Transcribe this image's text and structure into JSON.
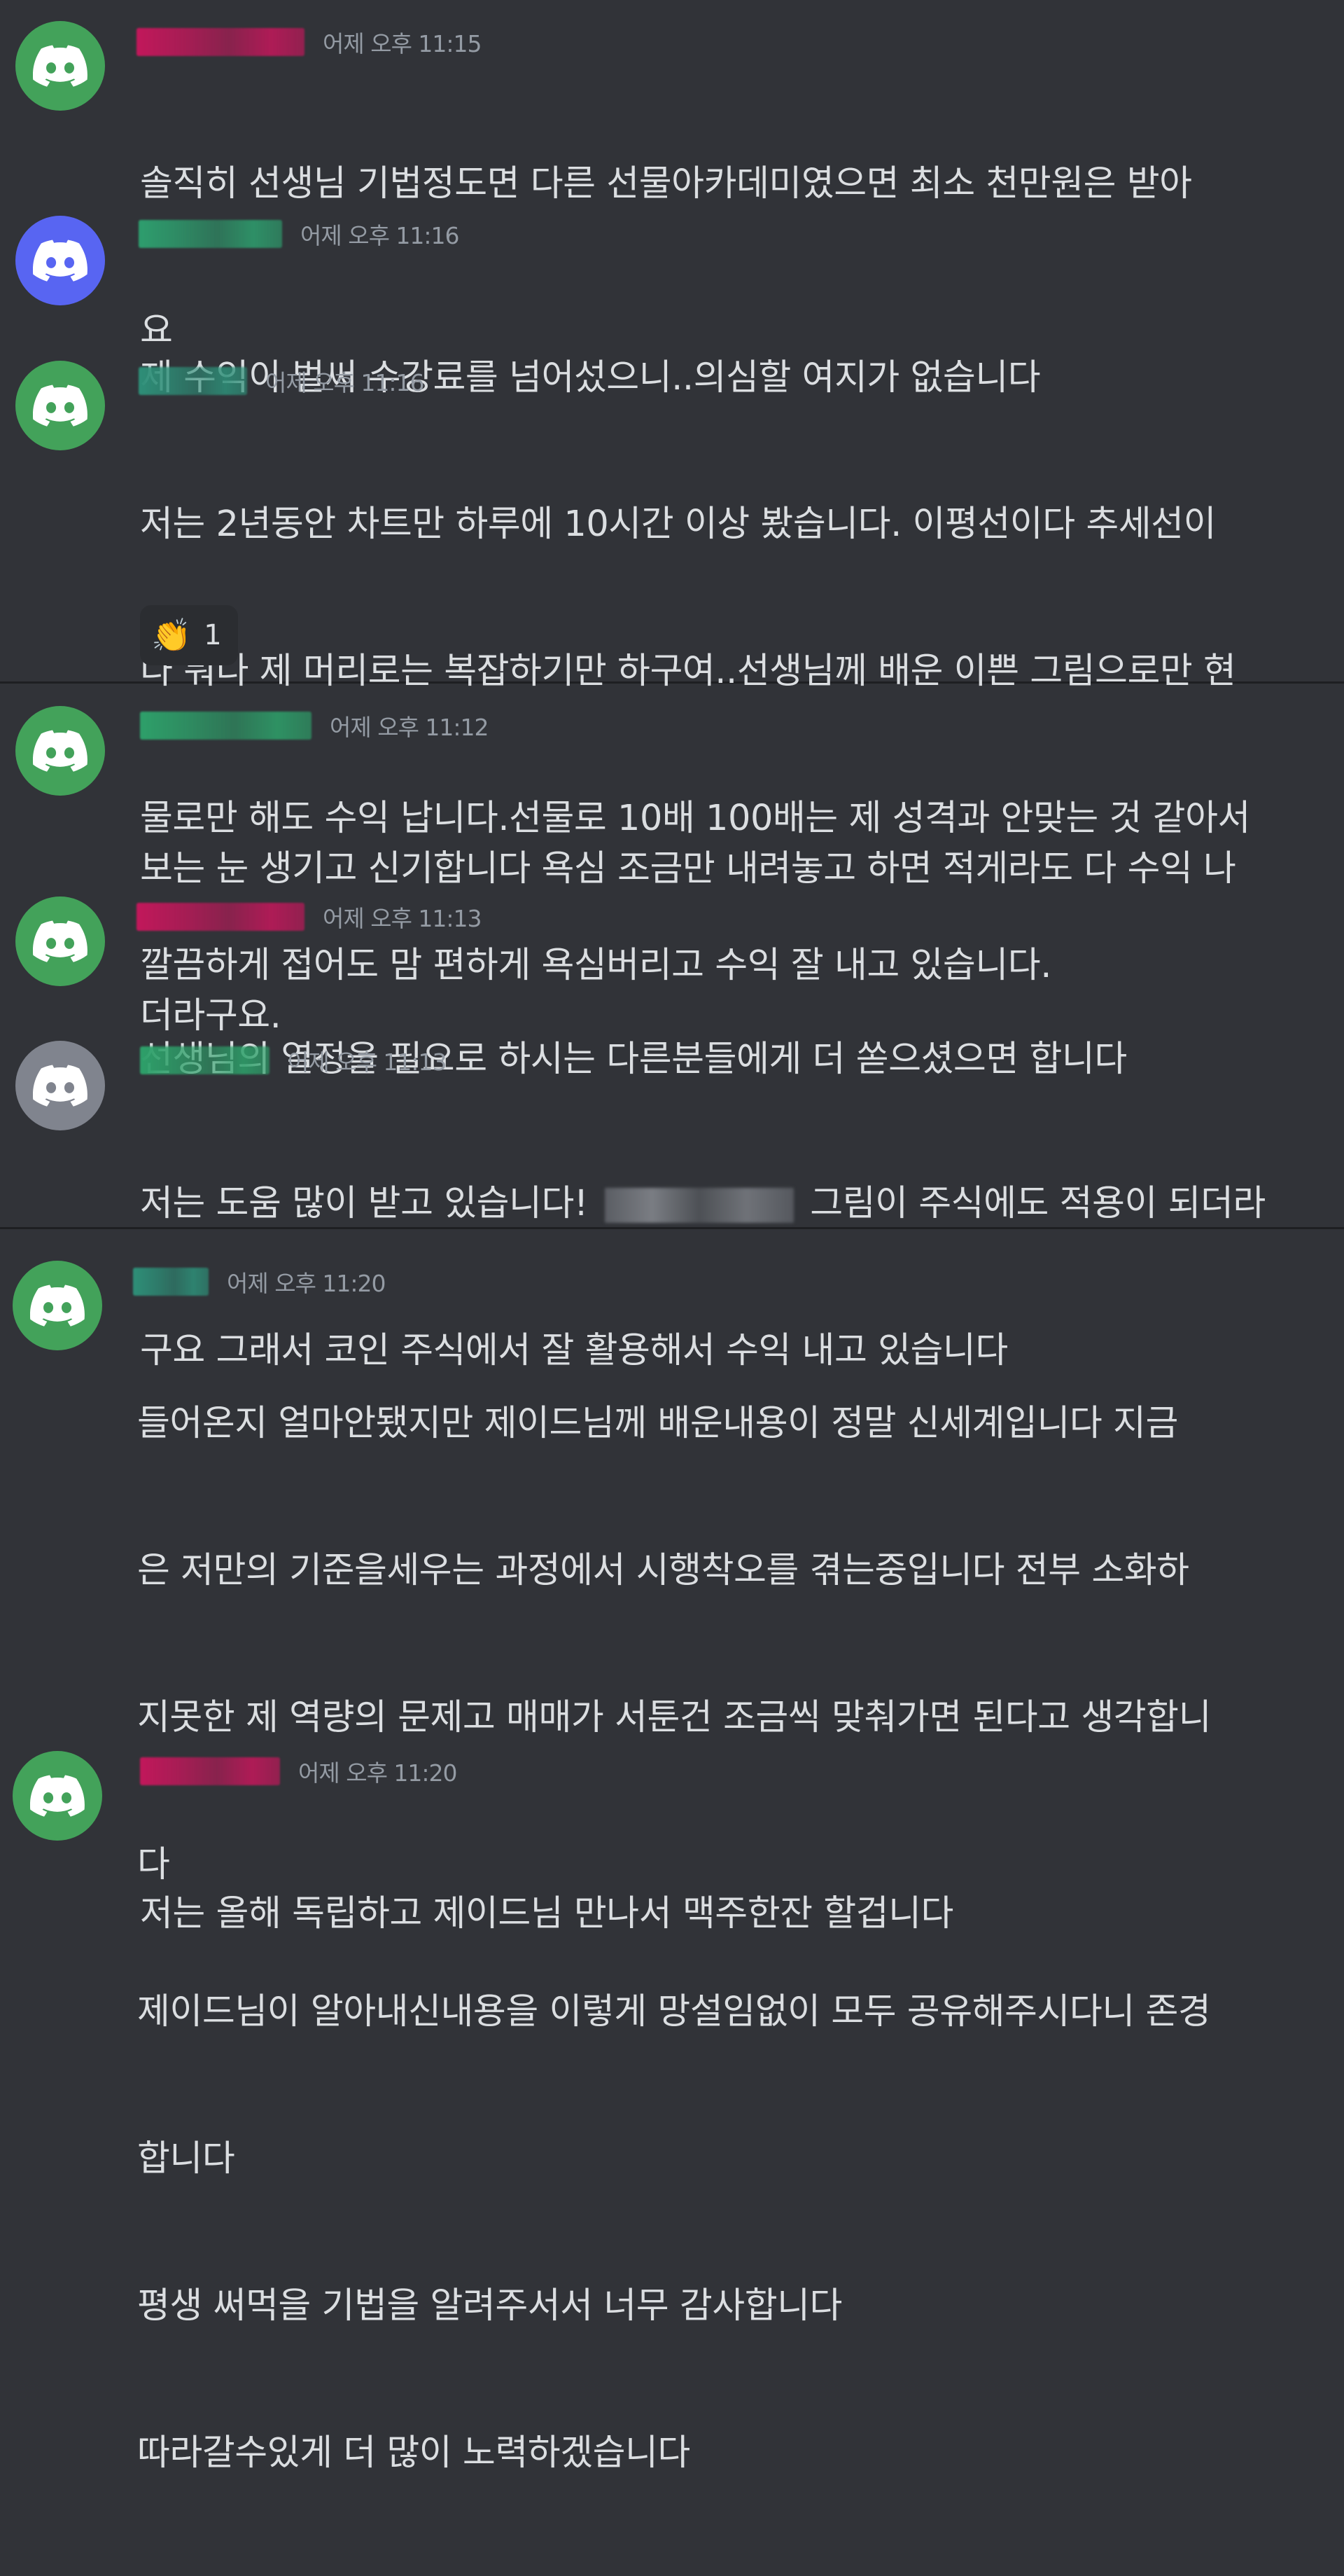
{
  "colors": {
    "background": "#313338",
    "divider": "#1e1f22",
    "text": "#dbdee1",
    "timestamp": "#949ba4",
    "avatar_green": "#43a25a",
    "avatar_blurple": "#5865f2",
    "avatar_gray": "#80848e"
  },
  "avatar_icon": "discord-logo-icon",
  "messages": [
    {
      "timestamp": "어제 오후 11:15",
      "avatar_color": "green",
      "username_color": "#c2185b",
      "lines": [
        "솔직히 선생님 기법정도면 다른 선물아카데미였으면 최소 천만원은 받아",
        "요"
      ]
    },
    {
      "timestamp": "어제 오후 11:16",
      "avatar_color": "blurple",
      "username_color": "#2e9e6e",
      "lines": [
        "제 수익이 벌써 수강료를 넘어섰으니..의심할 여지가 없습니다"
      ]
    },
    {
      "timestamp": "어제 오후 11:16",
      "avatar_color": "green",
      "username_color": "#2e8f78",
      "lines": [
        "저는 2년동안 차트만 하루에 10시간 이상 봤습니다. 이평선이다 추세선이",
        "다 뭐다 제 머리로는 복잡하기만 하구여..선생님께 배운 이쁜 그림으로만 현",
        "물로만 해도 수익 납니다.선물로 10배 100배는 제 성격과 안맞는 것 같아서",
        "깔끔하게 접어도 맘 편하게 욕심버리고 수익 잘 내고 있습니다."
      ],
      "reaction": {
        "emoji": "👏",
        "emoji_name": "clapping-hands-icon",
        "count": "1"
      }
    },
    {
      "timestamp": "어제 오후 11:12",
      "avatar_color": "green",
      "username_color": "#2ea06a",
      "lines": [
        "보는 눈 생기고 신기합니다 욕심 조금만 내려놓고 하면 적게라도 다 수익 나",
        "더라구요."
      ]
    },
    {
      "timestamp": "어제 오후 11:13",
      "avatar_color": "green",
      "username_color": "#c2185b",
      "lines": [
        "선생님의 열정을 필요로 하시는 다른분들에게 더 쏟으셨으면 합니다"
      ]
    },
    {
      "timestamp": "어제 오후 11:13",
      "avatar_color": "gray",
      "username_color": "#2ea06a",
      "line1_before": "저는 도움 많이 받고 있습니다! ",
      "line1_after": " 그림이 주식에도 적용이 되더라",
      "lines": [
        "구요 그래서 코인 주식에서 잘 활용해서 수익 내고 있습니다"
      ]
    },
    {
      "timestamp": "어제 오후 11:20",
      "avatar_color": "green",
      "username_color": "#2e8f78",
      "lines": [
        "들어온지 얼마안됐지만 제이드님께 배운내용이 정말 신세계입니다 지금",
        "은 저만의 기준을세우는 과정에서 시행착오를 겪는중입니다 전부 소화하",
        "지못한 제 역량의 문제고 매매가 서툰건 조금씩 맞춰가면 된다고 생각합니",
        "다",
        "제이드님이 알아내신내용을 이렇게 망설임없이 모두 공유해주시다니 존경",
        "합니다",
        "평생 써먹을 기법을 알려주서서 너무 감사합니다",
        "따라갈수있게 더 많이 노력하겠습니다"
      ]
    },
    {
      "timestamp": "어제 오후 11:20",
      "avatar_color": "green",
      "username_color": "#c2185b",
      "lines": [
        "저는 올해 독립하고 제이드님 만나서 맥주한잔 할겁니다"
      ]
    }
  ]
}
